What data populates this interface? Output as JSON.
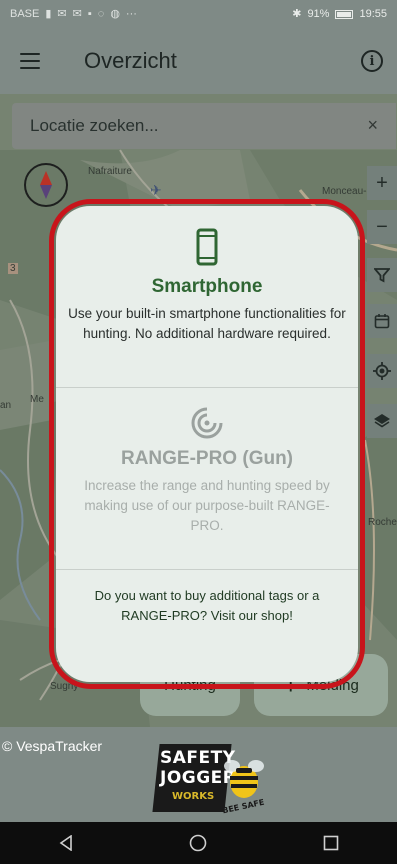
{
  "status_bar": {
    "carrier": "BASE",
    "battery": "91%",
    "time": "19:55",
    "icons": [
      "signal-icon",
      "mail-icon",
      "mail-icon",
      "notification-icon",
      "whatsapp-icon",
      "chrome-icon",
      "more-icon",
      "bluetooth-icon",
      "battery-icon"
    ]
  },
  "app_bar": {
    "title": "Overzicht",
    "menu_icon": "menu-icon",
    "info_icon": "info-icon"
  },
  "search": {
    "placeholder": "Locatie zoeken...",
    "clear": "×"
  },
  "map": {
    "labels": [
      "Nafraiture",
      "Monceau-en",
      "Me",
      "Roche",
      "Sugny",
      "an",
      "3"
    ],
    "tools": [
      {
        "icon": "zoom-in-icon",
        "glyph": "+"
      },
      {
        "icon": "zoom-out-icon",
        "glyph": "−"
      },
      {
        "icon": "filter-icon",
        "glyph": ""
      },
      {
        "icon": "calendar-icon",
        "glyph": ""
      },
      {
        "icon": "my-location-icon",
        "glyph": ""
      },
      {
        "icon": "layers-icon",
        "glyph": ""
      }
    ]
  },
  "modal": {
    "smartphone": {
      "icon": "smartphone-icon",
      "title": "Smartphone",
      "description": "Use your built-in smartphone functionalities for hunting. No additional hardware required."
    },
    "rangepro": {
      "icon": "target-icon",
      "title": "RANGE-PRO (Gun)",
      "description": "Increase the range and hunting speed by making use of our purpose-built RANGE-PRO."
    },
    "shop_text": "Do you want to buy additional tags or a RANGE-PRO? Visit our shop!"
  },
  "actions": {
    "hunting": "Hunting",
    "melding": "Melding",
    "melding_icon": "plus-icon"
  },
  "footer": {
    "copyright": "© VespaTracker",
    "logo_line1": "SAFETY",
    "logo_line2": "JOGGER",
    "logo_line3": "WORKS",
    "logo_badge": "BEE SAFE"
  },
  "nav": {
    "back": "back-icon",
    "home": "home-icon",
    "recents": "recents-icon"
  },
  "colors": {
    "accent_green": "#2f6633",
    "highlight_red": "#c8141b",
    "modal_bg": "#e8eeea"
  }
}
